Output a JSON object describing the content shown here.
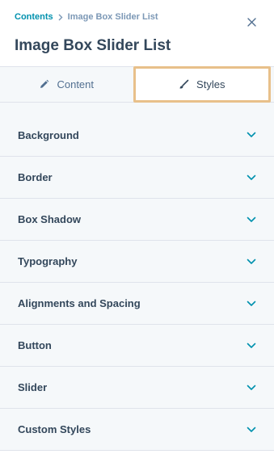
{
  "breadcrumb": {
    "link": "Contents",
    "current": "Image Box Slider List"
  },
  "title": "Image Box Slider List",
  "tabs": [
    {
      "label": "Content",
      "icon": "pencil-icon",
      "active": false
    },
    {
      "label": "Styles",
      "icon": "brush-icon",
      "active": true
    }
  ],
  "sections": [
    {
      "label": "Background"
    },
    {
      "label": "Border"
    },
    {
      "label": "Box Shadow"
    },
    {
      "label": "Typography"
    },
    {
      "label": "Alignments and Spacing"
    },
    {
      "label": "Button"
    },
    {
      "label": "Slider"
    },
    {
      "label": "Custom Styles"
    }
  ],
  "colors": {
    "accent": "#0091ae",
    "text": "#33475b",
    "active_tab_border": "#e8c08a",
    "panel_bg": "#f5f8fa"
  }
}
